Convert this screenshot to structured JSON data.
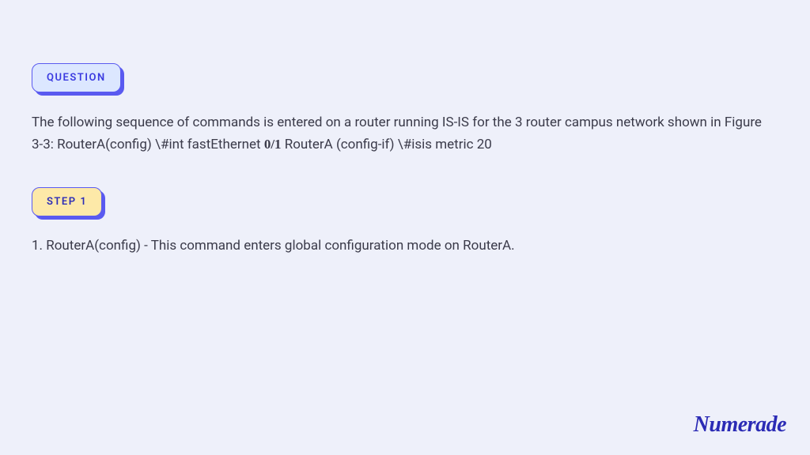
{
  "question": {
    "badge_label": "QUESTION",
    "text_before_math": "The following sequence of commands is entered on a router running IS-IS for the 3 router campus network shown in Figure 3-3: RouterA(config) \\#int fastEthernet ",
    "math": "0/1",
    "text_after_math": " RouterA (config-if) \\#isis metric 20"
  },
  "step": {
    "badge_label": "STEP 1",
    "text": "1. RouterA(config) - This command enters global configuration mode on RouterA."
  },
  "brand": "Numerade"
}
